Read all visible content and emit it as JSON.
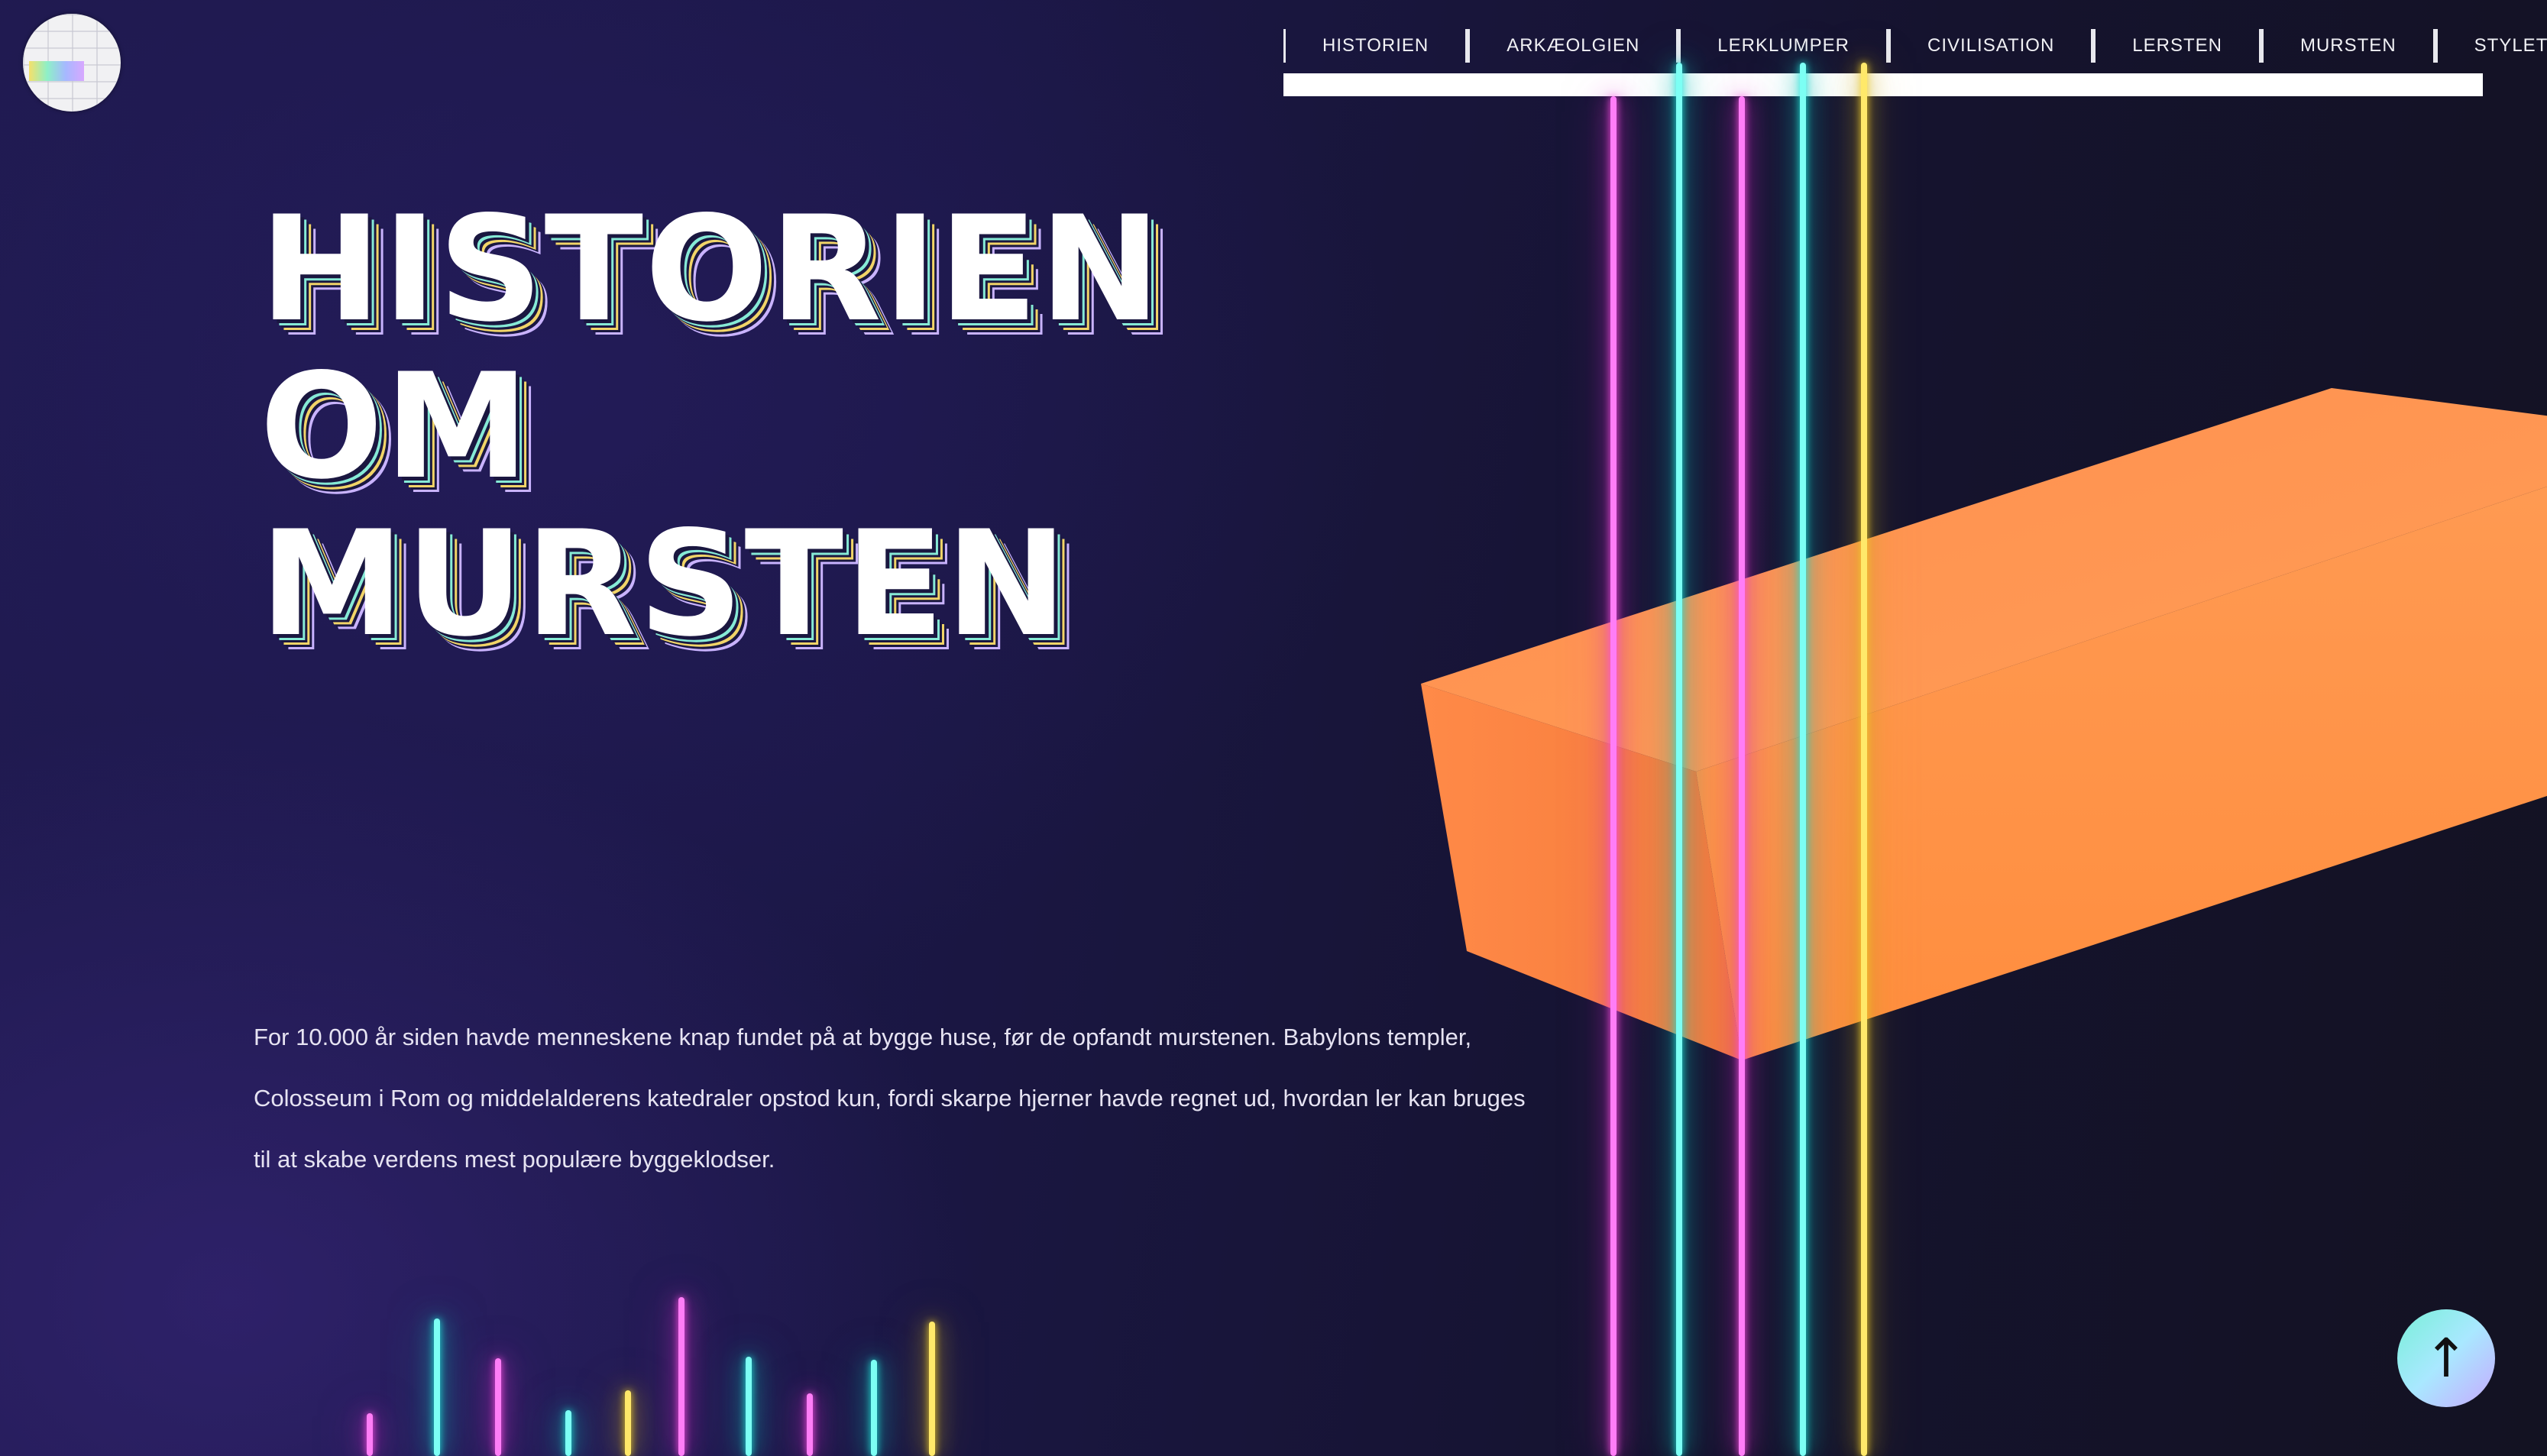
{
  "nav": {
    "items": [
      "HISTORIEN",
      "ARKÆOLGIEN",
      "LERKLUMPER",
      "CIVILISATION",
      "LERSTEN",
      "MURSTEN",
      "STYLETILE"
    ]
  },
  "hero": {
    "title_lines": [
      "HISTORIEN",
      "OM",
      "MURSTEN"
    ],
    "intro": "For 10.000 år siden havde menneskene knap fundet på at bygge huse, før de opfandt murstenen. Babylons templer, Colosseum i Rom og middelalderens katedraler opstod kun, fordi skarpe hjerner havde regnet ud, hvordan ler kan bruges til at skabe verdens mest populære byggeklodser."
  },
  "back_to_top": {
    "icon": "arrow-up-icon",
    "glyph": "↑"
  },
  "colors": {
    "neon_pink": "#ff7df7",
    "neon_cyan": "#7cfff4",
    "neon_yellow": "#ffe96a",
    "brick_orange": "#ff9a4d",
    "background": "#1b1746"
  }
}
